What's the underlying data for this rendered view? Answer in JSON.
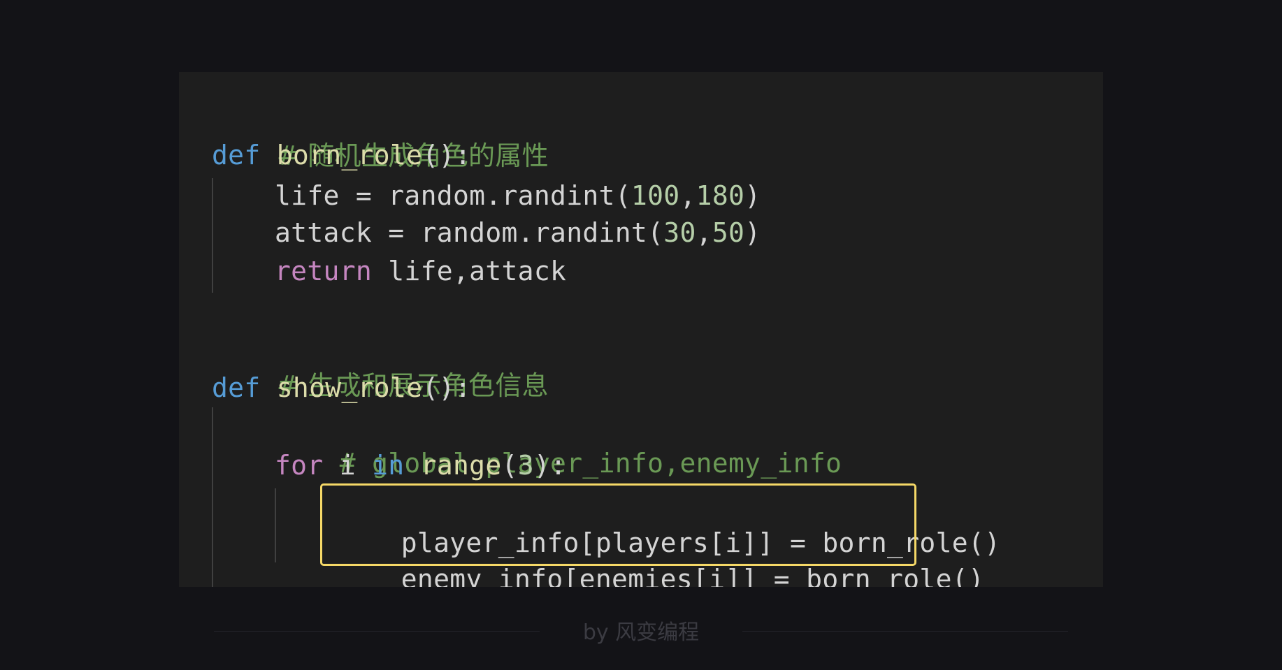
{
  "code": {
    "lines": [
      {
        "comment": "# 随机生成角色的属性"
      },
      {
        "kw": "def",
        "name": "born_role",
        "rest": "():"
      },
      {
        "a": "life = random.randint(",
        "n1": "100",
        "sep": ",",
        "n2": "180",
        "close": ")"
      },
      {
        "a": "attack = random.randint(",
        "n1": "30",
        "sep": ",",
        "n2": "50",
        "close": ")"
      },
      {
        "kw": "return",
        "rest": " life,attack"
      },
      {
        "comment": "# 生成和展示角色信息"
      },
      {
        "kw": "def",
        "name": "show_role",
        "rest": "():"
      },
      {
        "comment": "# global player_info,enemy_info"
      },
      {
        "kw": "for",
        "mid": " i ",
        "kw2": "in",
        "sp": " ",
        "fn": "range",
        "open": "(",
        "num": "3",
        "close": "):"
      },
      {
        "text": "player_info[players[i]] = born_role()"
      },
      {
        "text": "enemy_info[enemies[i]] = born_role()"
      }
    ]
  },
  "footer": {
    "text": "by 风变编程"
  },
  "colors": {
    "background": "#131317",
    "panel": "#1e1e1e",
    "comment": "#6a9955",
    "keyword_def": "#569cd6",
    "keyword_control": "#c586c0",
    "function": "#dcdcaa",
    "number": "#b5cea8",
    "highlight_border": "#f5d867"
  }
}
